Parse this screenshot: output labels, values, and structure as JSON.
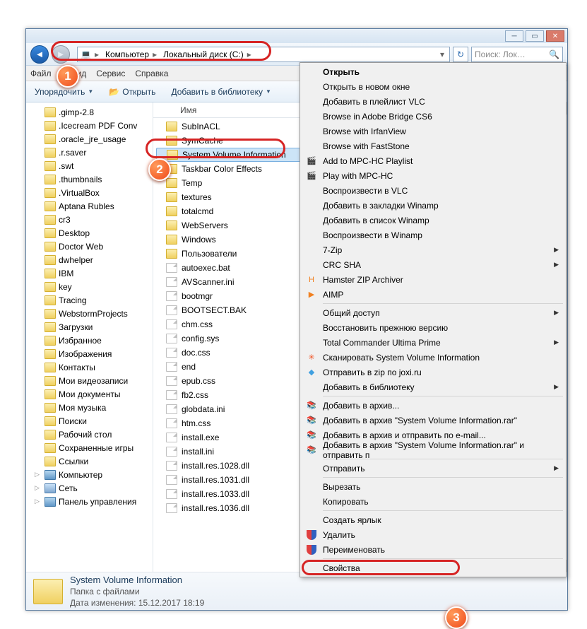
{
  "titlebtns": {
    "min": "─",
    "max": "▭",
    "close": "✕"
  },
  "nav": {
    "back": "◄",
    "fwd": "►"
  },
  "breadcrumb": {
    "computer": "Компьютер",
    "disk": "Локальный диск (C:)",
    "sep": "▸"
  },
  "addr_drop": "▾",
  "refresh": "↻",
  "search": {
    "placeholder": "Поиск: Лок…",
    "icon": "🔍"
  },
  "menubar": {
    "file": "Файл",
    "view": "Вид",
    "service": "Сервис",
    "help": "Справка"
  },
  "toolbar": {
    "organize": "Упорядочить",
    "open": "Открыть",
    "addlib": "Добавить в библиотеку"
  },
  "tree": [
    ".gimp-2.8",
    ".Icecream PDF Conv",
    ".oracle_jre_usage",
    ".r.saver",
    ".swt",
    ".thumbnails",
    ".VirtualBox",
    "Aptana Rubles",
    "cr3",
    "Desktop",
    "Doctor Web",
    "dwhelper",
    "IBM",
    "key",
    "Tracing",
    "WebstormProjects",
    "Загрузки",
    "Избранное",
    "Изображения",
    "Контакты",
    "Мои видеозаписи",
    "Мои документы",
    "Моя музыка",
    "Поиски",
    "Рабочий стол",
    "Сохраненные игры",
    "Ссылки"
  ],
  "tree_bottom": [
    {
      "label": "Компьютер",
      "cls": "sys"
    },
    {
      "label": "Сеть",
      "cls": "net"
    },
    {
      "label": "Панель управления",
      "cls": "sys"
    }
  ],
  "content_header": "Имя",
  "rows": [
    {
      "t": "SubInACL",
      "k": "d"
    },
    {
      "t": "SymCache",
      "k": "d"
    },
    {
      "t": "System Volume Information",
      "k": "d",
      "sel": true
    },
    {
      "t": "Taskbar Color Effects",
      "k": "d"
    },
    {
      "t": "Temp",
      "k": "d"
    },
    {
      "t": "textures",
      "k": "d"
    },
    {
      "t": "totalcmd",
      "k": "d"
    },
    {
      "t": "WebServers",
      "k": "d"
    },
    {
      "t": "Windows",
      "k": "d"
    },
    {
      "t": "Пользователи",
      "k": "d"
    },
    {
      "t": "autoexec.bat",
      "k": "f"
    },
    {
      "t": "AVScanner.ini",
      "k": "f"
    },
    {
      "t": "bootmgr",
      "k": "f"
    },
    {
      "t": "BOOTSECT.BAK",
      "k": "f"
    },
    {
      "t": "chm.css",
      "k": "f"
    },
    {
      "t": "config.sys",
      "k": "f"
    },
    {
      "t": "doc.css",
      "k": "f"
    },
    {
      "t": "end",
      "k": "f"
    },
    {
      "t": "epub.css",
      "k": "f"
    },
    {
      "t": "fb2.css",
      "k": "f"
    },
    {
      "t": "globdata.ini",
      "k": "f"
    },
    {
      "t": "htm.css",
      "k": "f"
    },
    {
      "t": "install.exe",
      "k": "f"
    },
    {
      "t": "install.ini",
      "k": "f"
    },
    {
      "t": "install.res.1028.dll",
      "k": "f"
    },
    {
      "t": "install.res.1031.dll",
      "k": "f"
    },
    {
      "t": "install.res.1033.dll",
      "k": "f"
    },
    {
      "t": "install.res.1036.dll",
      "k": "f"
    }
  ],
  "ctx": [
    {
      "t": "Открыть",
      "b": true
    },
    {
      "t": "Открыть в новом окне"
    },
    {
      "t": "Добавить в плейлист VLC"
    },
    {
      "t": "Browse in Adobe Bridge CS6"
    },
    {
      "t": "Browse with IrfanView"
    },
    {
      "t": "Browse with FastStone"
    },
    {
      "t": "Add to MPC-HC Playlist",
      "i": "🎬"
    },
    {
      "t": "Play with MPC-HC",
      "i": "🎬"
    },
    {
      "t": "Воспроизвести в VLC"
    },
    {
      "t": "Добавить в закладки Winamp"
    },
    {
      "t": "Добавить в список Winamp"
    },
    {
      "t": "Воспроизвести в Winamp"
    },
    {
      "t": "7-Zip",
      "a": true
    },
    {
      "t": "CRC SHA",
      "a": true
    },
    {
      "t": "Hamster ZIP Archiver",
      "i": "H",
      "ic": "#f08020"
    },
    {
      "t": "AIMP",
      "i": "▶",
      "ic": "#f08020"
    },
    {
      "sep": true
    },
    {
      "t": "Общий доступ",
      "a": true
    },
    {
      "t": "Восстановить прежнюю версию"
    },
    {
      "t": "Total Commander Ultima Prime",
      "a": true
    },
    {
      "t": "Сканировать System Volume Information",
      "i": "✳",
      "ic": "#f05020"
    },
    {
      "t": "Отправить в zip по joxi.ru",
      "i": "◆",
      "ic": "#40a0e0"
    },
    {
      "t": "Добавить в библиотеку",
      "a": true
    },
    {
      "sep": true
    },
    {
      "t": "Добавить в архив...",
      "i": "📚"
    },
    {
      "t": "Добавить в архив \"System Volume Information.rar\"",
      "i": "📚"
    },
    {
      "t": "Добавить в архив и отправить по e-mail...",
      "i": "📚"
    },
    {
      "t": "Добавить в архив \"System Volume Information.rar\" и отправить п",
      "i": "📚"
    },
    {
      "sep": true
    },
    {
      "t": "Отправить",
      "a": true
    },
    {
      "sep": true
    },
    {
      "t": "Вырезать"
    },
    {
      "t": "Копировать"
    },
    {
      "sep": true
    },
    {
      "t": "Создать ярлык"
    },
    {
      "t": "Удалить",
      "sh": true
    },
    {
      "t": "Переименовать",
      "sh": true
    },
    {
      "sep": true
    },
    {
      "t": "Свойства",
      "hl": true
    }
  ],
  "details": {
    "title": "System Volume Information",
    "type": "Папка с файлами",
    "date_lbl": "Дата изменения:",
    "date": "15.12.2017 18:19"
  },
  "badges": {
    "b1": "1",
    "b2": "2",
    "b3": "3"
  }
}
